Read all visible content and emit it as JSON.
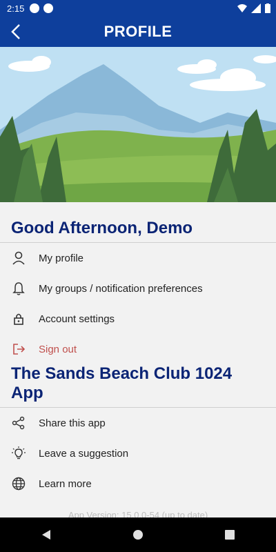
{
  "status_bar": {
    "time": "2:15"
  },
  "app_bar": {
    "title": "PROFILE",
    "back_icon": "chevron-left-icon"
  },
  "greeting": "Good Afternoon, Demo",
  "profile_menu": [
    {
      "label": "My profile",
      "icon": "person-icon"
    },
    {
      "label": "My groups / notification preferences",
      "icon": "bell-icon"
    },
    {
      "label": "Account settings",
      "icon": "lock-icon"
    },
    {
      "label": "Sign out",
      "icon": "sign-out-icon",
      "color": "#c0504d"
    }
  ],
  "app_section_title": "The Sands Beach Club 1024 App",
  "app_menu": [
    {
      "label": "Share this app",
      "icon": "share-icon"
    },
    {
      "label": "Leave a suggestion",
      "icon": "lightbulb-icon"
    },
    {
      "label": "Learn more",
      "icon": "globe-icon"
    }
  ],
  "app_version": "App Version: 15.0.0-54 (up to date)",
  "colors": {
    "primary": "#0e3f9c",
    "heading": "#0b2475",
    "signout": "#c0504d"
  }
}
